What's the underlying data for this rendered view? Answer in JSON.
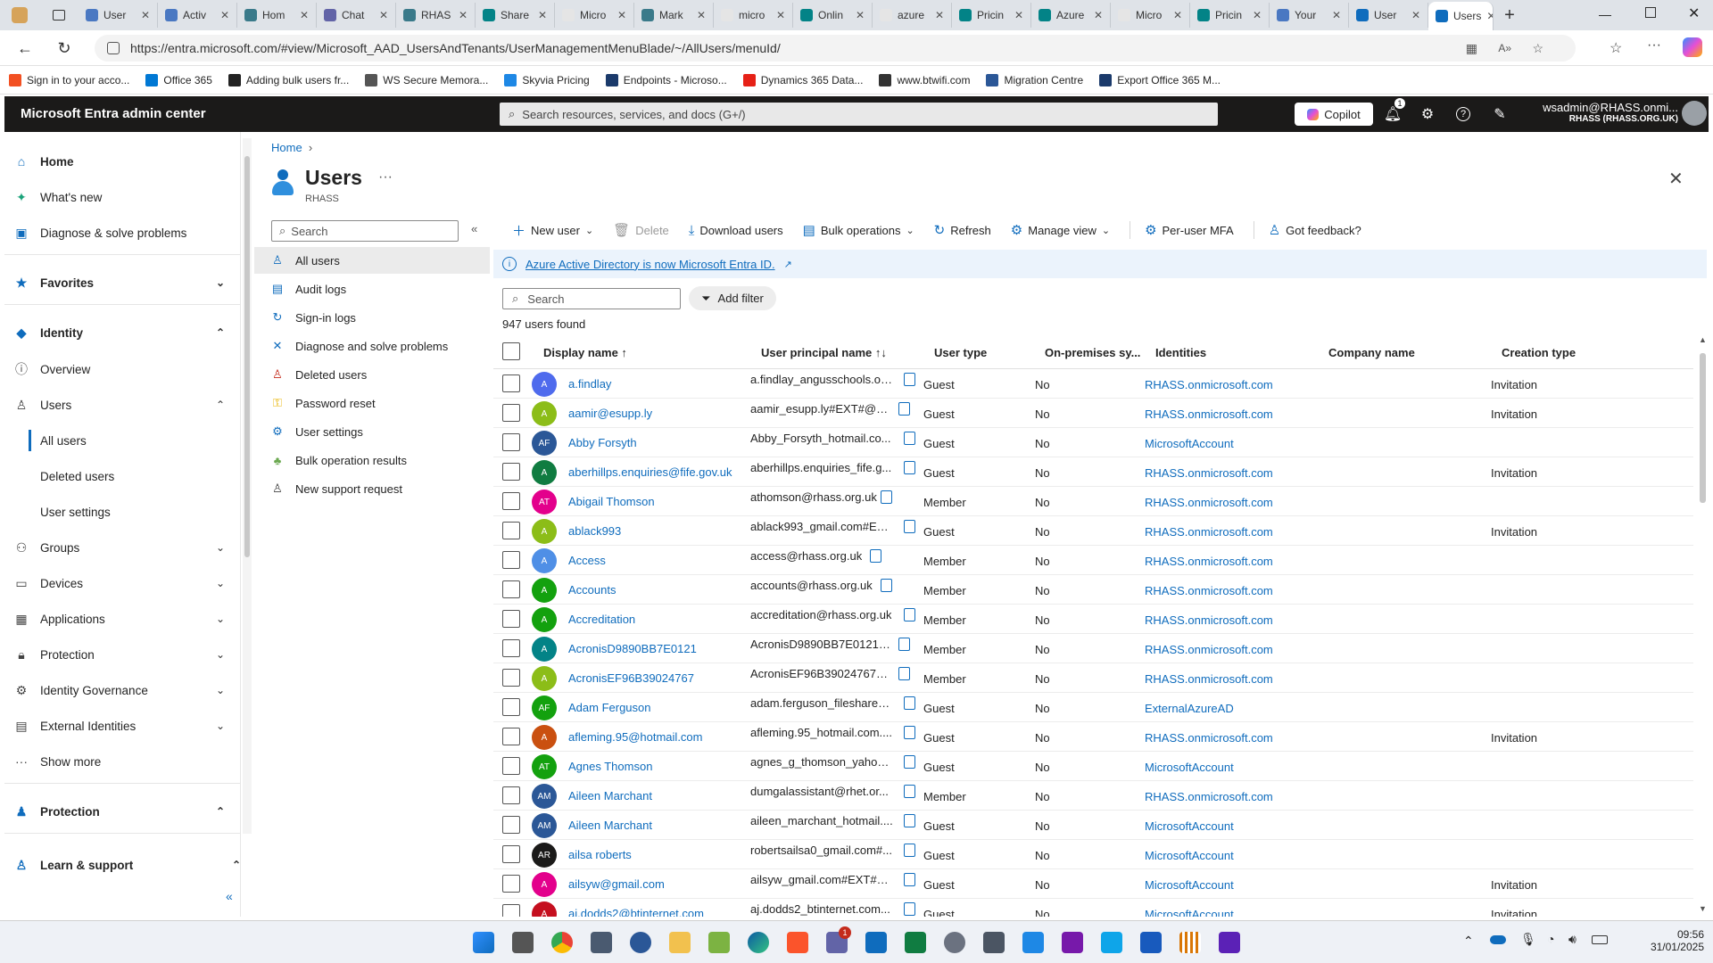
{
  "browser": {
    "tabs": [
      {
        "label": "User",
        "color": "#4a78c2"
      },
      {
        "label": "Activ",
        "color": "#4a78c2"
      },
      {
        "label": "Hom",
        "color": "#3a7a8a"
      },
      {
        "label": "Chat",
        "color": "#6264a7"
      },
      {
        "label": "RHAS",
        "color": "#3a7a8a"
      },
      {
        "label": "Share",
        "color": "#038387"
      },
      {
        "label": "Micro",
        "color": "#e5e5e5"
      },
      {
        "label": "Mark",
        "color": "#3a7a8a"
      },
      {
        "label": "micro",
        "color": "#e5e5e5"
      },
      {
        "label": "Onlin",
        "color": "#038387"
      },
      {
        "label": "azure",
        "color": "#e5e5e5"
      },
      {
        "label": "Pricin",
        "color": "#038387"
      },
      {
        "label": "Azure",
        "color": "#038387"
      },
      {
        "label": "Micro",
        "color": "#e5e5e5"
      },
      {
        "label": "Pricin",
        "color": "#038387"
      },
      {
        "label": "Your",
        "color": "#4a78c2"
      },
      {
        "label": "User",
        "color": "#0f6cbd"
      },
      {
        "label": "Users",
        "color": "#0f6cbd",
        "active": true
      }
    ],
    "url": "https://entra.microsoft.com/#view/Microsoft_AAD_UsersAndTenants/UserManagementMenuBlade/~/AllUsers/menuId/",
    "bookmarks": [
      {
        "label": "Sign in to your acco...",
        "color": "#f25022"
      },
      {
        "label": "Office 365",
        "color": "#0078d4"
      },
      {
        "label": "Adding bulk users fr...",
        "color": "#222222"
      },
      {
        "label": "WS Secure Memora...",
        "color": "#555555"
      },
      {
        "label": "Skyvia Pricing",
        "color": "#1e88e5"
      },
      {
        "label": "Endpoints - Microso...",
        "color": "#1b3a6b"
      },
      {
        "label": "Dynamics 365 Data...",
        "color": "#e62117"
      },
      {
        "label": "www.btwifi.com",
        "color": "#333333"
      },
      {
        "label": "Migration Centre",
        "color": "#2b5797"
      },
      {
        "label": "Export Office 365 M...",
        "color": "#1b3a6b"
      }
    ]
  },
  "header": {
    "title": "Microsoft Entra admin center",
    "search_placeholder": "Search resources, services, and docs (G+/)",
    "copilot": "Copilot",
    "notification_count": "1",
    "user_name": "wsadmin@RHASS.onmi...",
    "tenant": "RHASS (RHASS.ORG.UK)"
  },
  "leftnav": {
    "home": "Home",
    "whats_new": "What's new",
    "diagnose": "Diagnose & solve problems",
    "favorites": "Favorites",
    "identity": "Identity",
    "overview": "Overview",
    "users": "Users",
    "all_users": "All users",
    "deleted_users": "Deleted users",
    "user_settings": "User settings",
    "groups": "Groups",
    "devices": "Devices",
    "applications": "Applications",
    "protection": "Protection",
    "identity_governance": "Identity Governance",
    "external_identities": "External Identities",
    "show_more": "Show more",
    "protection_section": "Protection",
    "learn_support": "Learn & support"
  },
  "page": {
    "breadcrumb": "Home",
    "title": "Users",
    "subtitle": "RHASS",
    "menu_search": "Search",
    "menu": [
      "All users",
      "Audit logs",
      "Sign-in logs",
      "Diagnose and solve problems",
      "Deleted users",
      "Password reset",
      "User settings",
      "Bulk operation results",
      "New support request"
    ],
    "toolbar": {
      "new_user": "New user",
      "delete": "Delete",
      "download": "Download users",
      "bulk": "Bulk operations",
      "refresh": "Refresh",
      "manage_view": "Manage view",
      "per_user_mfa": "Per-user MFA",
      "feedback": "Got feedback?"
    },
    "info": "Azure Active Directory is now Microsoft Entra ID.",
    "table_search": "Search",
    "add_filter": "Add filter",
    "found": "947 users found",
    "columns": {
      "display_name": "Display name ↑",
      "upn": "User principal name ↑↓",
      "user_type": "User type",
      "on_prem": "On-premises sy...",
      "identities": "Identities",
      "company": "Company name",
      "creation": "Creation type"
    },
    "rows": [
      {
        "initials": "A",
        "color": "#4f6bed",
        "name": "a.findlay",
        "upn": "a.findlay_angusschools.or...",
        "type": "Guest",
        "onprem": "No",
        "identity": "RHASS.onmicrosoft.com",
        "creation": "Invitation"
      },
      {
        "initials": "A",
        "color": "#8cbd18",
        "name": "aamir@esupp.ly",
        "upn": "aamir_esupp.ly#EXT#@R...",
        "type": "Guest",
        "onprem": "No",
        "identity": "RHASS.onmicrosoft.com",
        "creation": "Invitation"
      },
      {
        "initials": "AF",
        "color": "#2b5797",
        "name": "Abby Forsyth",
        "upn": "Abby_Forsyth_hotmail.co...",
        "type": "Guest",
        "onprem": "No",
        "identity": "MicrosoftAccount",
        "creation": ""
      },
      {
        "initials": "A",
        "color": "#107c41",
        "name": "aberhillps.enquiries@fife.gov.uk",
        "upn": "aberhillps.enquiries_fife.g...",
        "type": "Guest",
        "onprem": "No",
        "identity": "RHASS.onmicrosoft.com",
        "creation": "Invitation"
      },
      {
        "initials": "AT",
        "color": "#e3008c",
        "name": "Abigail Thomson",
        "upn": "athomson@rhass.org.uk",
        "type": "Member",
        "onprem": "No",
        "identity": "RHASS.onmicrosoft.com",
        "creation": ""
      },
      {
        "initials": "A",
        "color": "#8cbd18",
        "name": "ablack993",
        "upn": "ablack993_gmail.com#EX...",
        "type": "Guest",
        "onprem": "No",
        "identity": "RHASS.onmicrosoft.com",
        "creation": "Invitation"
      },
      {
        "initials": "A",
        "color": "#4f8fe6",
        "name": "Access",
        "upn": "access@rhass.org.uk",
        "type": "Member",
        "onprem": "No",
        "identity": "RHASS.onmicrosoft.com",
        "creation": ""
      },
      {
        "initials": "A",
        "color": "#13a10e",
        "name": "Accounts",
        "upn": "accounts@rhass.org.uk",
        "type": "Member",
        "onprem": "No",
        "identity": "RHASS.onmicrosoft.com",
        "creation": ""
      },
      {
        "initials": "A",
        "color": "#13a10e",
        "name": "Accreditation",
        "upn": "accreditation@rhass.org.uk",
        "type": "Member",
        "onprem": "No",
        "identity": "RHASS.onmicrosoft.com",
        "creation": ""
      },
      {
        "initials": "A",
        "color": "#038387",
        "name": "AcronisD9890BB7E0121",
        "upn": "AcronisD9890BB7E0121@...",
        "type": "Member",
        "onprem": "No",
        "identity": "RHASS.onmicrosoft.com",
        "creation": ""
      },
      {
        "initials": "A",
        "color": "#8cbd18",
        "name": "AcronisEF96B39024767",
        "upn": "AcronisEF96B39024767@...",
        "type": "Member",
        "onprem": "No",
        "identity": "RHASS.onmicrosoft.com",
        "creation": ""
      },
      {
        "initials": "AF",
        "color": "#13a10e",
        "name": "Adam Ferguson",
        "upn": "adam.ferguson_fileshares...",
        "type": "Guest",
        "onprem": "No",
        "identity": "ExternalAzureAD",
        "creation": ""
      },
      {
        "initials": "A",
        "color": "#ca5010",
        "name": "afleming.95@hotmail.com",
        "upn": "afleming.95_hotmail.com....",
        "type": "Guest",
        "onprem": "No",
        "identity": "RHASS.onmicrosoft.com",
        "creation": "Invitation"
      },
      {
        "initials": "AT",
        "color": "#13a10e",
        "name": "Agnes Thomson",
        "upn": "agnes_g_thomson_yahoo....",
        "type": "Guest",
        "onprem": "No",
        "identity": "MicrosoftAccount",
        "creation": ""
      },
      {
        "initials": "AM",
        "color": "#2b5797",
        "name": "Aileen Marchant",
        "upn": "dumgalassistant@rhet.or...",
        "type": "Member",
        "onprem": "No",
        "identity": "RHASS.onmicrosoft.com",
        "creation": ""
      },
      {
        "initials": "AM",
        "color": "#2b5797",
        "name": "Aileen Marchant",
        "upn": "aileen_marchant_hotmail....",
        "type": "Guest",
        "onprem": "No",
        "identity": "MicrosoftAccount",
        "creation": ""
      },
      {
        "initials": "AR",
        "color": "#1b1a19",
        "name": "ailsa roberts",
        "upn": "robertsailsa0_gmail.com#...",
        "type": "Guest",
        "onprem": "No",
        "identity": "MicrosoftAccount",
        "creation": ""
      },
      {
        "initials": "A",
        "color": "#e3008c",
        "name": "ailsyw@gmail.com",
        "upn": "ailsyw_gmail.com#EXT#@...",
        "type": "Guest",
        "onprem": "No",
        "identity": "MicrosoftAccount",
        "creation": "Invitation"
      },
      {
        "initials": "A",
        "color": "#c50f1f",
        "name": "aj.dodds2@btinternet.com",
        "upn": "aj.dodds2_btinternet.com...",
        "type": "Guest",
        "onprem": "No",
        "identity": "MicrosoftAccount",
        "creation": "Invitation"
      }
    ]
  },
  "taskbar": {
    "time": "09:56",
    "date": "31/01/2025",
    "teams_badge": "1"
  }
}
